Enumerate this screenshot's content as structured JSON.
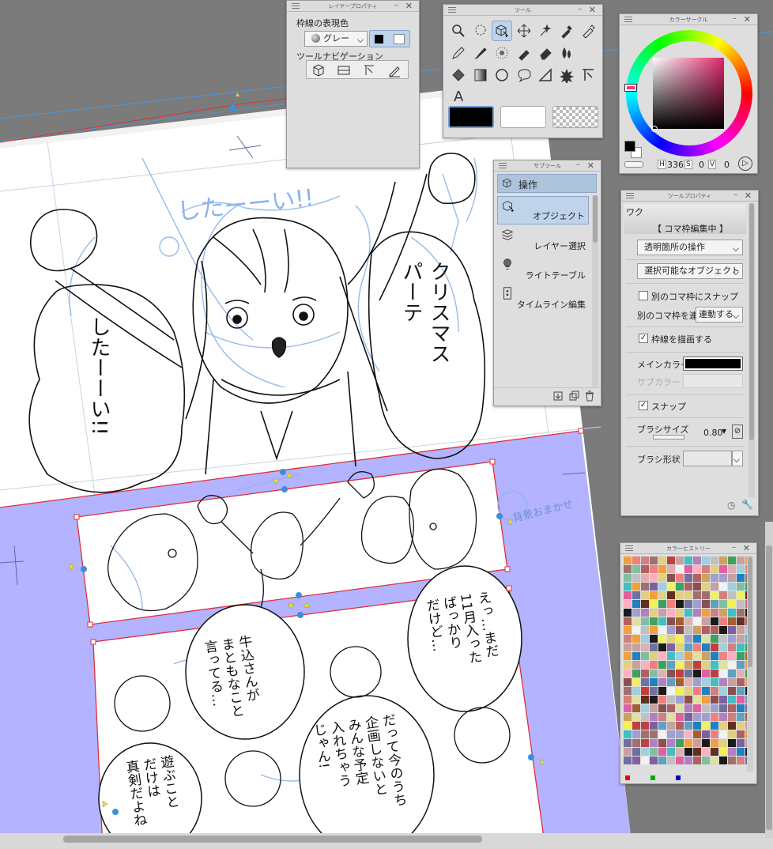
{
  "layer_property_panel": {
    "title": "レイヤープロパティ",
    "line_color_label": "枠線の表現色",
    "color_mode_value": "グレー",
    "tool_nav_label": "ツールナビゲーション"
  },
  "tool_panel": {
    "title": "ツール"
  },
  "sub_tool_panel": {
    "title": "サブツール",
    "header_label": "操作",
    "items": [
      {
        "label": "オブジェクト",
        "icon": "object-select-icon"
      },
      {
        "label": "レイヤー選択",
        "icon": "layer-select-icon"
      },
      {
        "label": "ライトテーブル",
        "icon": "light-table-icon"
      },
      {
        "label": "タイムライン編集",
        "icon": "timeline-edit-icon"
      }
    ]
  },
  "color_circle_panel": {
    "title": "カラーサークル",
    "h_value": "336",
    "s_value": "0",
    "v_value": "0",
    "h_label": "H",
    "s_label": "S",
    "v_label": "V"
  },
  "tool_property_panel": {
    "title": "ツールプロパティ",
    "tab_label": "ワク",
    "mode_label": "【 コマ枠編集中 】",
    "transparent_op": "透明箇所の操作",
    "selectable_obj": "選択可能なオブジェクト",
    "snap_other_frame": "別のコマ枠にスナップ",
    "link_other_frame_label": "別のコマ枠を連動",
    "link_other_frame_value": "連動する",
    "draw_frame_line": "枠線を描画する",
    "main_color_label": "メインカラー",
    "sub_color_label": "サブカラー",
    "snap": "スナップ",
    "brush_size_label": "ブラシサイズ",
    "brush_size_value": "0.80",
    "brush_shape_label": "ブラシ形状"
  },
  "color_history_panel": {
    "title": "カラーヒストリー"
  },
  "canvas_text": {
    "bubble1": "したーーい!!",
    "bubble2_line1": "クリスマス",
    "bubble2_line2": "パーテ",
    "bg_sketch": "したーーい!!",
    "note_margin": "背景おまかせ",
    "bubble3": [
      "えっ…まだ",
      "11月入った",
      "ばっかり",
      "だけど…"
    ],
    "bubble4": [
      "牛込さんが",
      "まともなこと",
      "言ってる…"
    ],
    "bubble5": [
      "だって今のうち",
      "企画しないと",
      "みんな予定",
      "入れちゃう",
      "じゃん!"
    ],
    "bubble6": [
      "遊ぶこと",
      "だけは",
      "真剣だよね"
    ]
  },
  "colors": {
    "canvas_bg": "#7b7b7b",
    "frame_selection": "#b3b3ff",
    "frame_border": "#e0303a",
    "sketch_blue": "#8fb4e8",
    "main_color": "#000000"
  }
}
